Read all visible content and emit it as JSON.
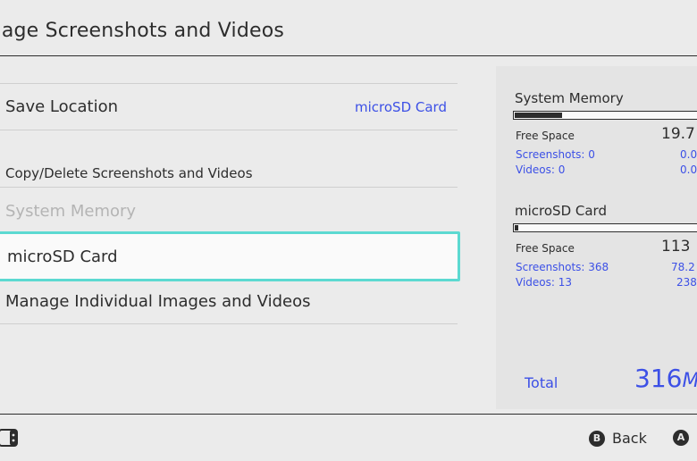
{
  "header": {
    "title": "anage Screenshots and Videos"
  },
  "menu": {
    "save_location_label": "Save Location",
    "save_location_value": "microSD Card",
    "copy_delete_header": "Copy/Delete Screenshots and Videos",
    "system_memory_item": "System Memory",
    "microsd_item": "microSD Card",
    "manage_individual": "Manage Individual Images and Videos"
  },
  "panel": {
    "system_memory": {
      "title": "System Memory",
      "usage_fraction": 0.25,
      "free_space_label": "Free Space",
      "free_space_value": "19.7",
      "screenshots_label": "Screenshots: 0",
      "screenshots_value": "0.0",
      "videos_label": "Videos: 0",
      "videos_value": "0.0"
    },
    "microsd": {
      "title": "microSD Card",
      "usage_fraction": 0.02,
      "free_space_label": "Free Space",
      "free_space_value": "113",
      "screenshots_label": "Screenshots: 368",
      "screenshots_value": "78.2",
      "videos_label": "Videos: 13",
      "videos_value": "238"
    },
    "total_label": "Total",
    "total_value": "316",
    "total_unit": "M"
  },
  "footer": {
    "back_button_glyph": "B",
    "back_label": "Back",
    "a_button_glyph": "A",
    "controller_icon": "joy-con-controller-icon"
  },
  "colors": {
    "accent_blue": "#3c50e6",
    "selection_outline": "#5cd9d1",
    "background": "#ebebeb"
  }
}
